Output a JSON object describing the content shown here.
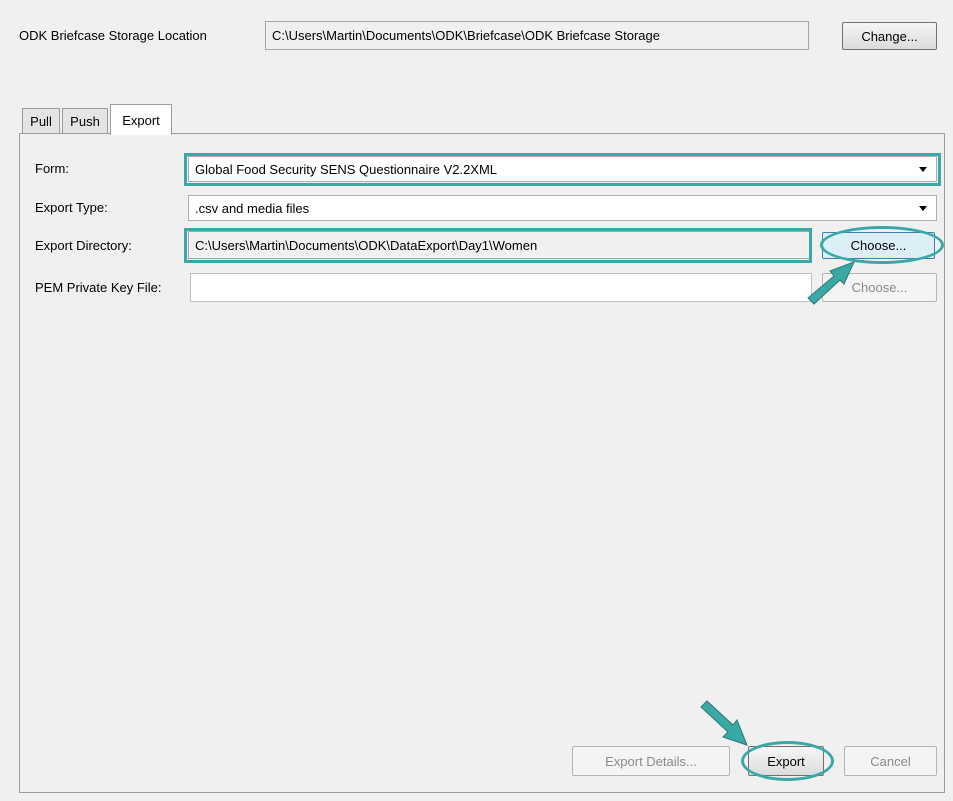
{
  "top": {
    "storage_label": "ODK Briefcase Storage Location",
    "storage_path": "C:\\Users\\Martin\\Documents\\ODK\\Briefcase\\ODK Briefcase Storage",
    "change_button": "Change..."
  },
  "tabs": [
    {
      "label": "Pull",
      "active": false
    },
    {
      "label": "Push",
      "active": false
    },
    {
      "label": "Export",
      "active": true
    }
  ],
  "export": {
    "form_label": "Form:",
    "form_value": "Global Food Security SENS Questionnaire V2.2XML",
    "export_type_label": "Export Type:",
    "export_type_value": ".csv and media files",
    "directory_label": "Export Directory:",
    "directory_value": "C:\\Users\\Martin\\Documents\\ODK\\DataExport\\Day1\\Women",
    "directory_choose_button": "Choose...",
    "pem_label": "PEM Private Key File:",
    "pem_value": "",
    "pem_choose_button": "Choose..."
  },
  "footer": {
    "export_details_button": "Export Details...",
    "export_button": "Export",
    "cancel_button": "Cancel"
  },
  "annotations": {
    "highlight_color": "#3aa8a4",
    "arrow_color": "#3aa8a4"
  }
}
